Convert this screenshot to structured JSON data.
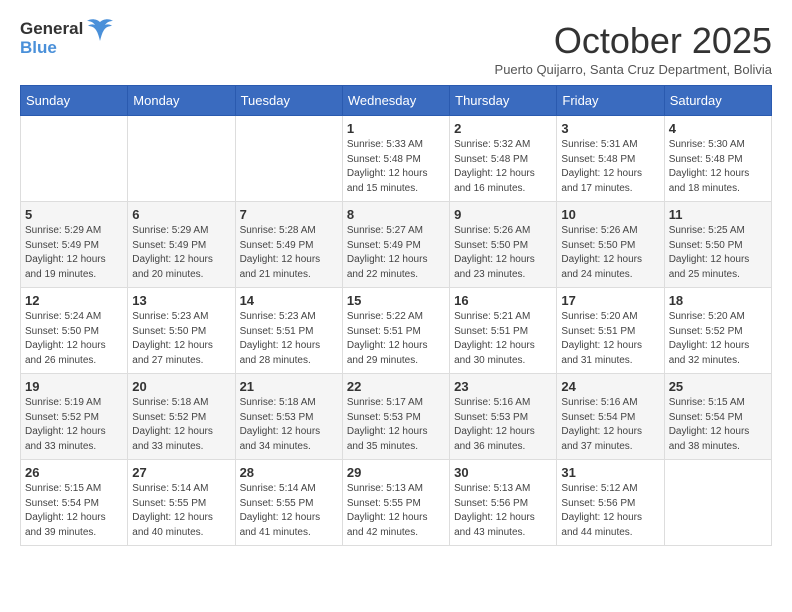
{
  "header": {
    "logo_general": "General",
    "logo_blue": "Blue",
    "month_year": "October 2025",
    "location": "Puerto Quijarro, Santa Cruz Department, Bolivia"
  },
  "days_of_week": [
    "Sunday",
    "Monday",
    "Tuesday",
    "Wednesday",
    "Thursday",
    "Friday",
    "Saturday"
  ],
  "weeks": [
    [
      {
        "day": "",
        "info": ""
      },
      {
        "day": "",
        "info": ""
      },
      {
        "day": "",
        "info": ""
      },
      {
        "day": "1",
        "info": "Sunrise: 5:33 AM\nSunset: 5:48 PM\nDaylight: 12 hours\nand 15 minutes."
      },
      {
        "day": "2",
        "info": "Sunrise: 5:32 AM\nSunset: 5:48 PM\nDaylight: 12 hours\nand 16 minutes."
      },
      {
        "day": "3",
        "info": "Sunrise: 5:31 AM\nSunset: 5:48 PM\nDaylight: 12 hours\nand 17 minutes."
      },
      {
        "day": "4",
        "info": "Sunrise: 5:30 AM\nSunset: 5:48 PM\nDaylight: 12 hours\nand 18 minutes."
      }
    ],
    [
      {
        "day": "5",
        "info": "Sunrise: 5:29 AM\nSunset: 5:49 PM\nDaylight: 12 hours\nand 19 minutes."
      },
      {
        "day": "6",
        "info": "Sunrise: 5:29 AM\nSunset: 5:49 PM\nDaylight: 12 hours\nand 20 minutes."
      },
      {
        "day": "7",
        "info": "Sunrise: 5:28 AM\nSunset: 5:49 PM\nDaylight: 12 hours\nand 21 minutes."
      },
      {
        "day": "8",
        "info": "Sunrise: 5:27 AM\nSunset: 5:49 PM\nDaylight: 12 hours\nand 22 minutes."
      },
      {
        "day": "9",
        "info": "Sunrise: 5:26 AM\nSunset: 5:50 PM\nDaylight: 12 hours\nand 23 minutes."
      },
      {
        "day": "10",
        "info": "Sunrise: 5:26 AM\nSunset: 5:50 PM\nDaylight: 12 hours\nand 24 minutes."
      },
      {
        "day": "11",
        "info": "Sunrise: 5:25 AM\nSunset: 5:50 PM\nDaylight: 12 hours\nand 25 minutes."
      }
    ],
    [
      {
        "day": "12",
        "info": "Sunrise: 5:24 AM\nSunset: 5:50 PM\nDaylight: 12 hours\nand 26 minutes."
      },
      {
        "day": "13",
        "info": "Sunrise: 5:23 AM\nSunset: 5:50 PM\nDaylight: 12 hours\nand 27 minutes."
      },
      {
        "day": "14",
        "info": "Sunrise: 5:23 AM\nSunset: 5:51 PM\nDaylight: 12 hours\nand 28 minutes."
      },
      {
        "day": "15",
        "info": "Sunrise: 5:22 AM\nSunset: 5:51 PM\nDaylight: 12 hours\nand 29 minutes."
      },
      {
        "day": "16",
        "info": "Sunrise: 5:21 AM\nSunset: 5:51 PM\nDaylight: 12 hours\nand 30 minutes."
      },
      {
        "day": "17",
        "info": "Sunrise: 5:20 AM\nSunset: 5:51 PM\nDaylight: 12 hours\nand 31 minutes."
      },
      {
        "day": "18",
        "info": "Sunrise: 5:20 AM\nSunset: 5:52 PM\nDaylight: 12 hours\nand 32 minutes."
      }
    ],
    [
      {
        "day": "19",
        "info": "Sunrise: 5:19 AM\nSunset: 5:52 PM\nDaylight: 12 hours\nand 33 minutes."
      },
      {
        "day": "20",
        "info": "Sunrise: 5:18 AM\nSunset: 5:52 PM\nDaylight: 12 hours\nand 33 minutes."
      },
      {
        "day": "21",
        "info": "Sunrise: 5:18 AM\nSunset: 5:53 PM\nDaylight: 12 hours\nand 34 minutes."
      },
      {
        "day": "22",
        "info": "Sunrise: 5:17 AM\nSunset: 5:53 PM\nDaylight: 12 hours\nand 35 minutes."
      },
      {
        "day": "23",
        "info": "Sunrise: 5:16 AM\nSunset: 5:53 PM\nDaylight: 12 hours\nand 36 minutes."
      },
      {
        "day": "24",
        "info": "Sunrise: 5:16 AM\nSunset: 5:54 PM\nDaylight: 12 hours\nand 37 minutes."
      },
      {
        "day": "25",
        "info": "Sunrise: 5:15 AM\nSunset: 5:54 PM\nDaylight: 12 hours\nand 38 minutes."
      }
    ],
    [
      {
        "day": "26",
        "info": "Sunrise: 5:15 AM\nSunset: 5:54 PM\nDaylight: 12 hours\nand 39 minutes."
      },
      {
        "day": "27",
        "info": "Sunrise: 5:14 AM\nSunset: 5:55 PM\nDaylight: 12 hours\nand 40 minutes."
      },
      {
        "day": "28",
        "info": "Sunrise: 5:14 AM\nSunset: 5:55 PM\nDaylight: 12 hours\nand 41 minutes."
      },
      {
        "day": "29",
        "info": "Sunrise: 5:13 AM\nSunset: 5:55 PM\nDaylight: 12 hours\nand 42 minutes."
      },
      {
        "day": "30",
        "info": "Sunrise: 5:13 AM\nSunset: 5:56 PM\nDaylight: 12 hours\nand 43 minutes."
      },
      {
        "day": "31",
        "info": "Sunrise: 5:12 AM\nSunset: 5:56 PM\nDaylight: 12 hours\nand 44 minutes."
      },
      {
        "day": "",
        "info": ""
      }
    ]
  ]
}
